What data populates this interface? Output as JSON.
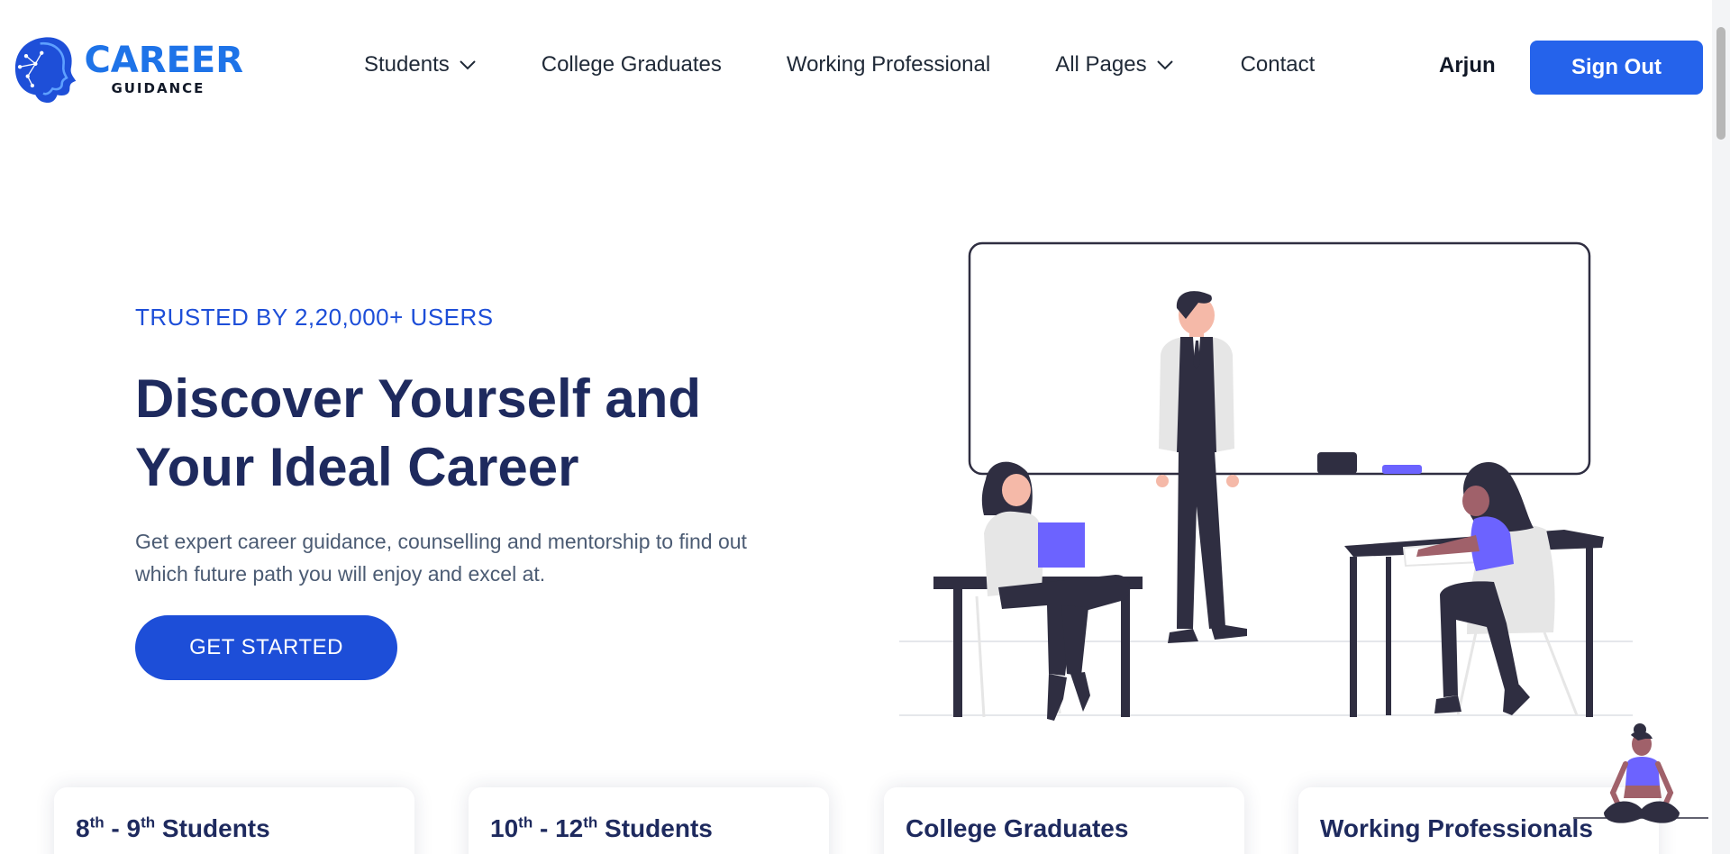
{
  "brand": {
    "name": "CAREER",
    "tagline": "GUIDANCE",
    "logo_icon": "head-circuit-logo-icon"
  },
  "nav": {
    "students": "Students",
    "college_graduates": "College Graduates",
    "working_professional": "Working Professional",
    "all_pages": "All Pages",
    "contact": "Contact"
  },
  "user": {
    "name": "Arjun",
    "signout_label": "Sign Out"
  },
  "hero": {
    "trusted": "TRUSTED BY 2,20,000+ USERS",
    "title_line1": "Discover Yourself and",
    "title_line2": "Your Ideal Career",
    "description": "Get expert career guidance, counselling and mentorship to find out which future path you will enjoy and excel at.",
    "cta": "GET STARTED",
    "illustration": "classroom-illustration"
  },
  "cards": [
    {
      "pre": "8",
      "pre_sup": "th",
      "mid": " - 9",
      "mid_sup": "th",
      "post": " Students"
    },
    {
      "pre": "10",
      "pre_sup": "th",
      "mid": " - 12",
      "mid_sup": "th",
      "post": " Students"
    },
    {
      "title": "College Graduates"
    },
    {
      "title": "Working Professionals"
    }
  ],
  "colors": {
    "primary": "#2563eb",
    "cta": "#1d4ed8",
    "heading": "#1e2a5e",
    "accent_purple": "#6c63ff",
    "figure_dark": "#2f2e41"
  }
}
